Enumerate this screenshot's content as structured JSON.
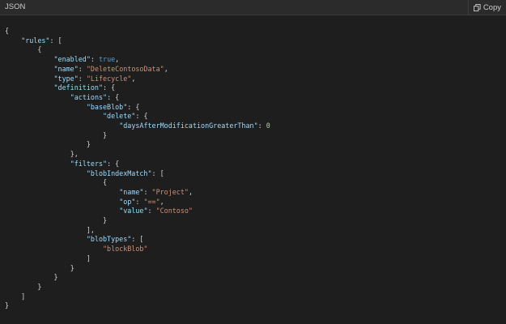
{
  "header": {
    "language_label": "JSON",
    "copy_label": "Copy"
  },
  "code": {
    "rules_key": "\"rules\"",
    "enabled_key": "\"enabled\"",
    "enabled_value": "true",
    "name_key": "\"name\"",
    "name_value": "\"DeleteContosoData\"",
    "type_key": "\"type\"",
    "type_value": "\"Lifecycle\"",
    "definition_key": "\"definition\"",
    "actions_key": "\"actions\"",
    "baseBlob_key": "\"baseBlob\"",
    "delete_key": "\"delete\"",
    "days_key": "\"daysAfterModificationGreaterThan\"",
    "days_value": "0",
    "filters_key": "\"filters\"",
    "blobIndexMatch_key": "\"blobIndexMatch\"",
    "match_name_key": "\"name\"",
    "match_name_value": "\"Project\"",
    "match_op_key": "\"op\"",
    "match_op_value": "\"==\"",
    "match_value_key": "\"value\"",
    "match_value_value": "\"Contoso\"",
    "blobTypes_key": "\"blobTypes\"",
    "blobTypes_item": "\"blockBlob\""
  }
}
